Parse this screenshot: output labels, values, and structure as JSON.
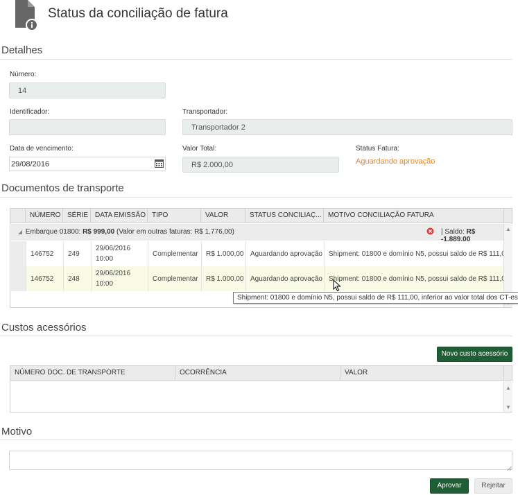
{
  "header": {
    "title": "Status da conciliação de fatura",
    "icon": "document-info-icon"
  },
  "detalhes": {
    "section_title": "Detalhes",
    "numero_label": "Número:",
    "numero_value": "14",
    "identificador_label": "Identificador:",
    "identificador_value": "",
    "transportador_label": "Transportador:",
    "transportador_value": "Transportador 2",
    "vencimento_label": "Data de vencimento:",
    "vencimento_value": "29/08/2016",
    "valor_total_label": "Valor Total:",
    "valor_total_value": "R$ 2.000,00",
    "status_label": "Status Fatura:",
    "status_value": "Aguardando aprovação",
    "status_color": "#e8841c"
  },
  "documentos": {
    "section_title": "Documentos de transporte",
    "columns": [
      "NÚMERO",
      "SÉRIE",
      "DATA EMISSÃO",
      "TIPO",
      "VALOR",
      "STATUS CONCILIAÇ...",
      "MOTIVO CONCILIAÇÃO FATURA"
    ],
    "group": {
      "prefix": "Embarque 01800: ",
      "amount": "R$ 999,00",
      "suffix": " (Valor em outras faturas: R$ 1.776,00)",
      "saldo_label": "| Saldo: ",
      "saldo_value": "R$ -1.889,00"
    },
    "rows": [
      {
        "numero": "146752",
        "serie": "249",
        "data_line1": "29/06/2016",
        "data_line2": "10:00",
        "tipo": "Complementar",
        "valor": "R$ 1.000,00",
        "status": "Aguardando aprovação",
        "motivo": "Shipment: 01800 e domínio N5, possui saldo de R$ 111,0..."
      },
      {
        "numero": "146752",
        "serie": "248",
        "data_line1": "29/06/2016",
        "data_line2": "10:00",
        "tipo": "Complementar",
        "valor": "R$ 1.000,00",
        "status": "Aguardando aprovação",
        "motivo": "Shipment: 01800 e domínio N5, possui saldo de R$ 111,0..."
      }
    ],
    "tooltip": "Shipment: 01800 e domínio N5, possui saldo de R$ 111,00, inferior ao valor total dos CT-es"
  },
  "custos": {
    "section_title": "Custos acessórios",
    "new_button": "Novo custo acessório",
    "columns": [
      "NÚMERO DOC. DE TRANSPORTE",
      "OCORRÊNCIA",
      "VALOR"
    ]
  },
  "motivo": {
    "section_title": "Motivo",
    "value": ""
  },
  "actions": {
    "approve": "Aprovar",
    "reject": "Rejeitar"
  },
  "colors": {
    "primary": "#1f5e34",
    "selected_row": "#fafbe6",
    "error": "#e53935"
  }
}
